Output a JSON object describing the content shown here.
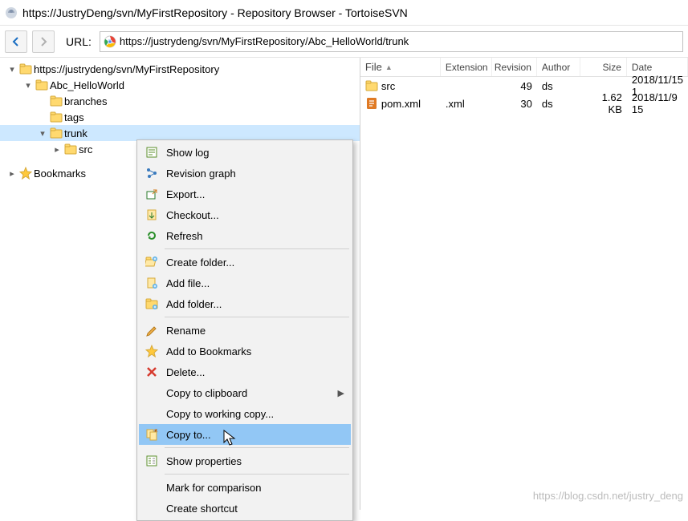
{
  "window": {
    "title": "https://JustryDeng/svn/MyFirstRepository - Repository Browser - TortoiseSVN"
  },
  "toolbar": {
    "url_label": "URL:",
    "url_value": "https://justrydeng/svn/MyFirstRepository/Abc_HelloWorld/trunk"
  },
  "tree": {
    "root": {
      "label": "https://justrydeng/svn/MyFirstRepository"
    },
    "project": {
      "label": "Abc_HelloWorld"
    },
    "branches": {
      "label": "branches"
    },
    "tags": {
      "label": "tags"
    },
    "trunk": {
      "label": "trunk"
    },
    "src": {
      "label": "src"
    },
    "bookmarks": {
      "label": "Bookmarks"
    }
  },
  "filelist": {
    "headers": {
      "file": "File",
      "ext": "Extension",
      "rev": "Revision",
      "author": "Author",
      "size": "Size",
      "date": "Date"
    },
    "rows": [
      {
        "name": "src",
        "ext": "",
        "rev": "49",
        "author": "ds",
        "size": "",
        "date": "2018/11/15 1"
      },
      {
        "name": "pom.xml",
        "ext": ".xml",
        "rev": "30",
        "author": "ds",
        "size": "1.62 KB",
        "date": "2018/11/9 15"
      }
    ]
  },
  "context_menu": {
    "show_log": "Show log",
    "revision_graph": "Revision graph",
    "export": "Export...",
    "checkout": "Checkout...",
    "refresh": "Refresh",
    "create_folder": "Create folder...",
    "add_file": "Add file...",
    "add_folder": "Add folder...",
    "rename": "Rename",
    "add_bookmarks": "Add to Bookmarks",
    "delete": "Delete...",
    "copy_clipboard": "Copy to clipboard",
    "copy_wc": "Copy to working copy...",
    "copy_to": "Copy to...",
    "show_props": "Show properties",
    "mark_compare": "Mark for comparison",
    "create_shortcut": "Create shortcut"
  },
  "watermark": "https://blog.csdn.net/justry_deng"
}
